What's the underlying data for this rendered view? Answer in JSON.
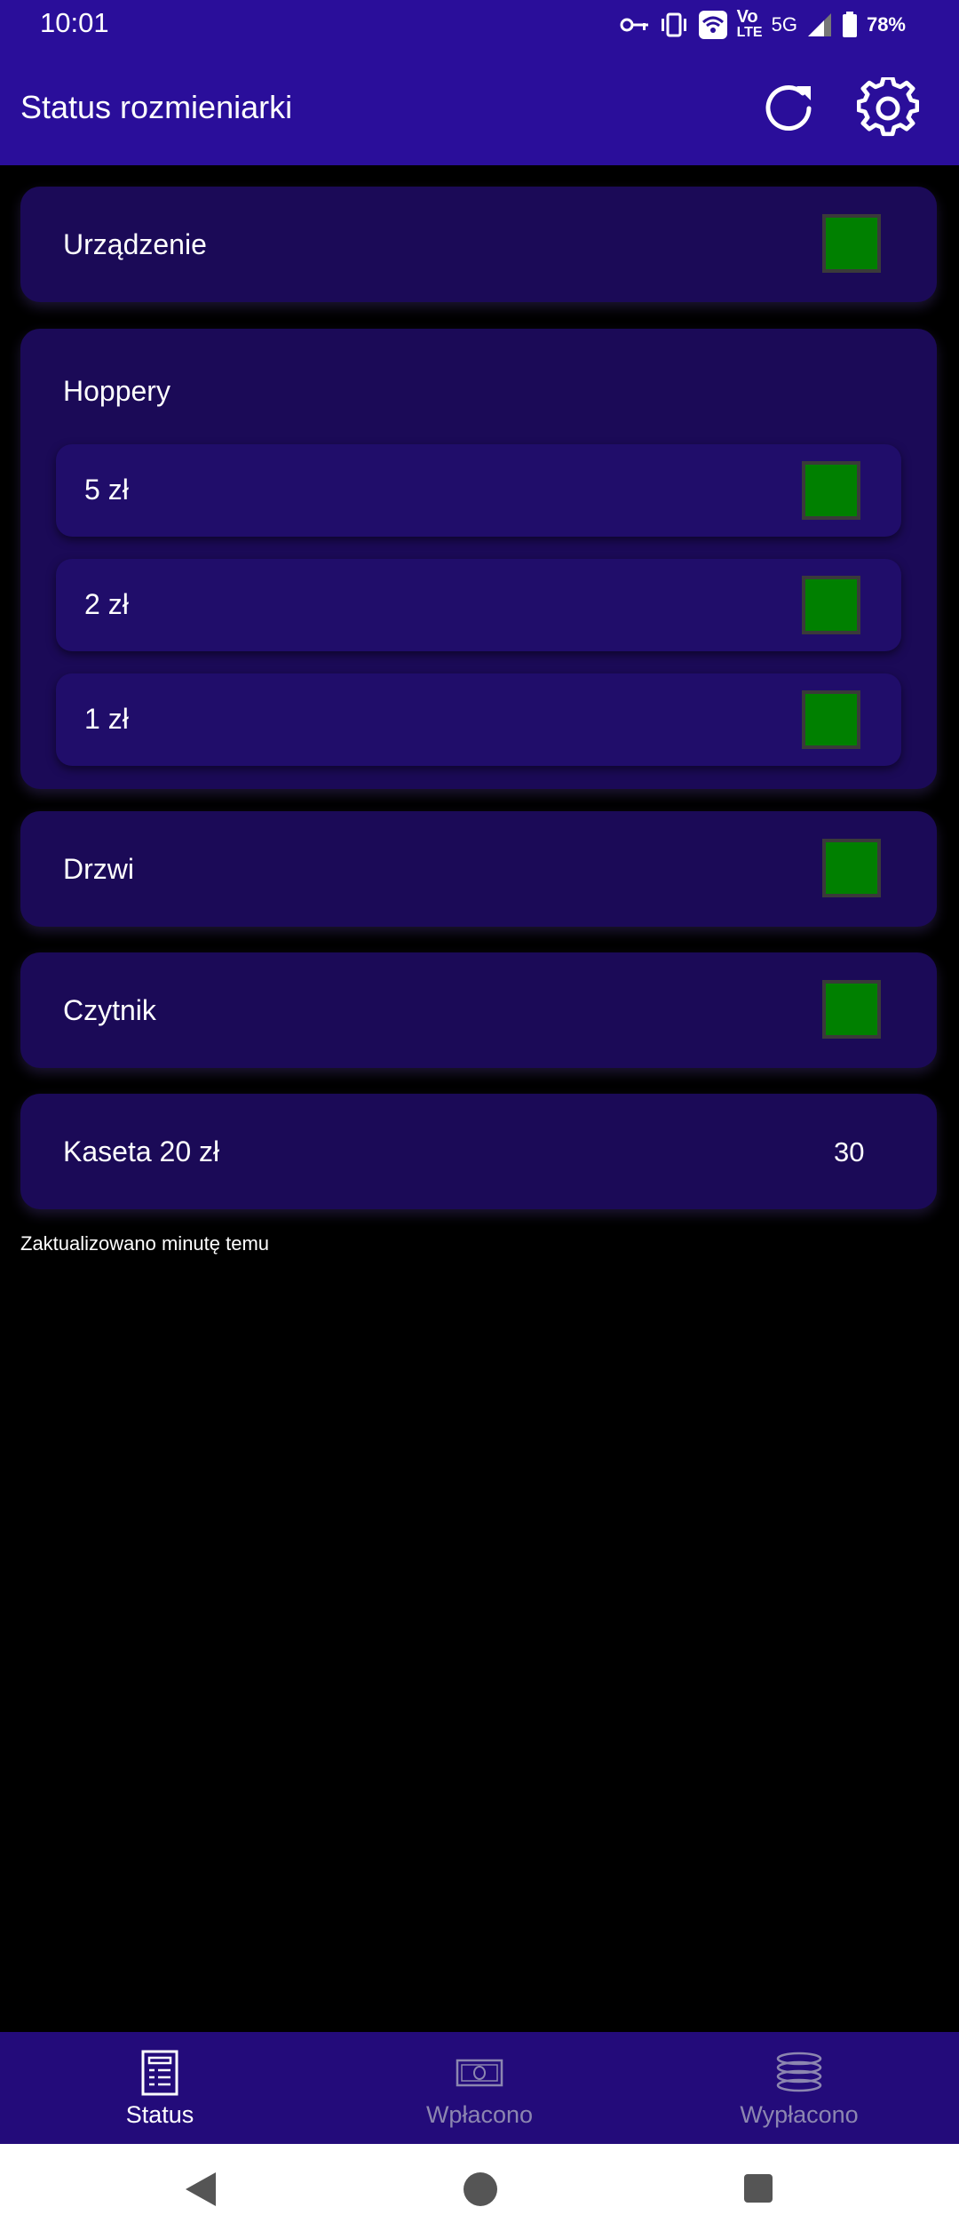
{
  "status_bar": {
    "time": "10:01",
    "network": "5G",
    "volte": "Vo",
    "lte": "LTE",
    "battery": "78%"
  },
  "app_bar": {
    "title": "Status rozmieniarki"
  },
  "cards": {
    "device": {
      "label": "Urządzenie",
      "status_color": "#008000"
    },
    "hoppers": {
      "label": "Hoppery",
      "items": [
        {
          "label": "5 zł",
          "status_color": "#008000"
        },
        {
          "label": "2 zł",
          "status_color": "#008000"
        },
        {
          "label": "1 zł",
          "status_color": "#008000"
        }
      ]
    },
    "door": {
      "label": "Drzwi",
      "status_color": "#008000"
    },
    "reader": {
      "label": "Czytnik",
      "status_color": "#008000"
    },
    "cassette": {
      "label": "Kaseta 20 zł",
      "value": "30"
    }
  },
  "updated_text": "Zaktualizowano minutę temu",
  "bottom_nav": [
    {
      "label": "Status",
      "icon": "receipt-icon",
      "active": true
    },
    {
      "label": "Wpłacono",
      "icon": "banknote-icon",
      "active": false
    },
    {
      "label": "Wypłacono",
      "icon": "coins-icon",
      "active": false
    }
  ],
  "colors": {
    "primary": "#2a0e9a",
    "card": "#1b0a57",
    "ok": "#008000"
  }
}
